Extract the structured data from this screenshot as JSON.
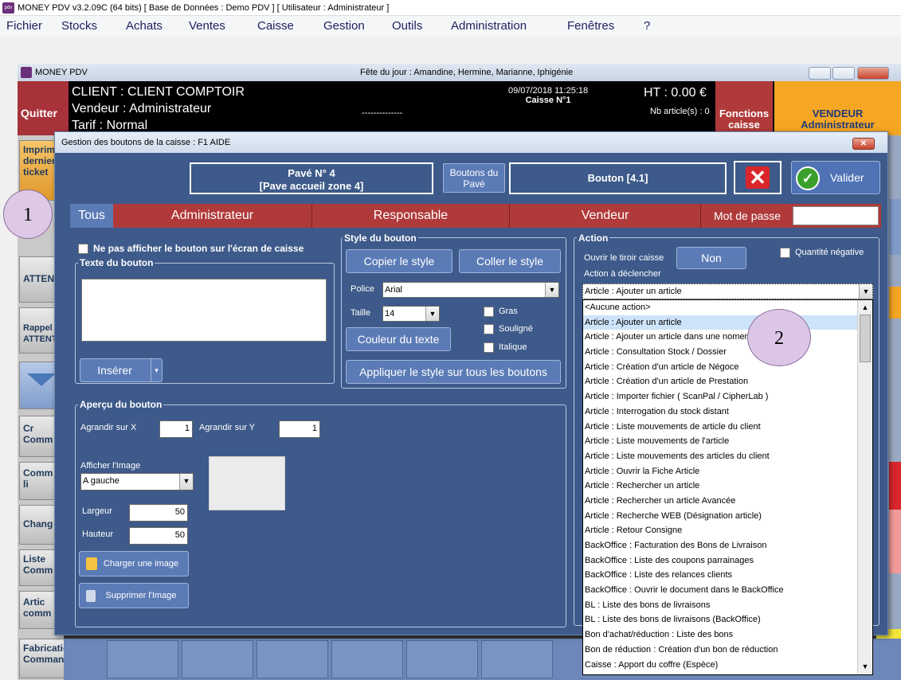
{
  "titlebar": {
    "text": "MONEY PDV v3.2.09C (64 bits) [ Base de Données : Demo PDV ] [ Utilisateur : Administrateur ]",
    "icon": "pdv"
  },
  "menu": [
    "Fichier",
    "Stocks",
    "Achats",
    "Ventes",
    "Caisse",
    "Gestion",
    "Outils",
    "Administration",
    "Fenêtres",
    "?"
  ],
  "inner_window": {
    "title": "MONEY PDV",
    "fete": "Fête du jour : Amandine, Hermine, Marianne, Iphigénie"
  },
  "pos": {
    "quit": "Quitter",
    "client": "CLIENT : CLIENT COMPTOIR",
    "vendeur": "Vendeur : Administrateur",
    "tarif": "Tarif : Normal",
    "dashes": "--------------",
    "date": "09/07/2018 11:25:18",
    "caisse": "Caisse N°1",
    "ht": "HT : 0.00 €",
    "nb_articles": "Nb article(s) : 0",
    "fonctions": "Fonctions caisse",
    "vendeur_btn_title": "VENDEUR",
    "vendeur_btn_name": "Administrateur"
  },
  "left_tiles": [
    "Imprimer dernier ticket",
    "ATTENTE",
    "Rappel ATTENTE",
    "Cr Comm",
    "Comm li",
    "Chang",
    "Liste Comm",
    "Artic comm",
    "Fabrication Commande"
  ],
  "dialog": {
    "title": "Gestion des boutons de la caisse : F1 AIDE",
    "pave": "Pavé N° 4",
    "pave_sub": "[Pave accueil zone 4]",
    "boutons_du_pave": "Boutons du Pavé",
    "bouton": "Bouton [4.1]",
    "valider": "Valider",
    "tabs": [
      "Tous",
      "Administrateur",
      "Responsable",
      "Vendeur"
    ],
    "mot_de_passe": "Mot de passe",
    "ne_pas_afficher": "Ne pas afficher le bouton sur l'écran de caisse",
    "texte_du_bouton": "Texte du bouton",
    "inserer": "Insérer",
    "style": {
      "title": "Style du bouton",
      "copier": "Copier le style",
      "coller": "Coller le style",
      "police_label": "Police",
      "police_value": "Arial",
      "taille_label": "Taille",
      "taille_value": "14",
      "gras": "Gras",
      "souligne": "Souligné",
      "italique": "Italique",
      "couleur": "Couleur du texte",
      "appliquer": "Appliquer le style sur tous les boutons"
    },
    "apercu": {
      "title": "Aperçu du bouton",
      "agrandir_x": "Agrandir sur X",
      "agrandir_x_value": "1",
      "agrandir_y": "Agrandir sur Y",
      "agrandir_y_value": "1",
      "afficher_image": "Afficher l'Image",
      "afficher_image_value": "A gauche",
      "largeur": "Largeur",
      "largeur_value": "50",
      "hauteur": "Hauteur",
      "hauteur_value": "50",
      "charger": "Charger une image",
      "supprimer": "Supprimer l'Image"
    },
    "action": {
      "title": "Action",
      "ouvrir_tiroir": "Ouvrir le tiroir caisse",
      "tiroir_value": "Non",
      "quantite_negative": "Quantité négative",
      "action_a_declencher": "Action à déclencher",
      "selected": "Article : Ajouter un article"
    },
    "dropdown_items": [
      "<Aucune action>",
      "Article : Ajouter un article",
      "Article : Ajouter un article dans une nomenclature",
      "Article : Consultation Stock / Dossier",
      "Article : Création d'un article de Négoce",
      "Article : Création d'un article de Prestation",
      "Article : Importer fichier ( ScanPal / CipherLab )",
      "Article : Interrogation du stock distant",
      "Article : Liste mouvements de article du client",
      "Article : Liste mouvements de l'article",
      "Article : Liste mouvements des articles du client",
      "Article : Ouvrir la Fiche Article",
      "Article : Rechercher un article",
      "Article : Rechercher un article Avancée",
      "Article : Recherche WEB (Désignation article)",
      "Article : Retour Consigne",
      "BackOffice : Facturation des Bons de Livraison",
      "BackOffice : Liste des coupons parrainages",
      "BackOffice : Liste des relances clients",
      "BackOffice : Ouvrir le document dans le BackOffice",
      "BL : Liste des bons de livraisons",
      "BL : Liste des bons de livraisons  (BackOffice)",
      "Bon d'achat/réduction : Liste des bons",
      "Bon de réduction : Création d'un bon de réduction",
      "Caisse : Apport du coffre (Espèce)"
    ],
    "selected_index": 1
  },
  "markers": [
    "1",
    "2"
  ]
}
